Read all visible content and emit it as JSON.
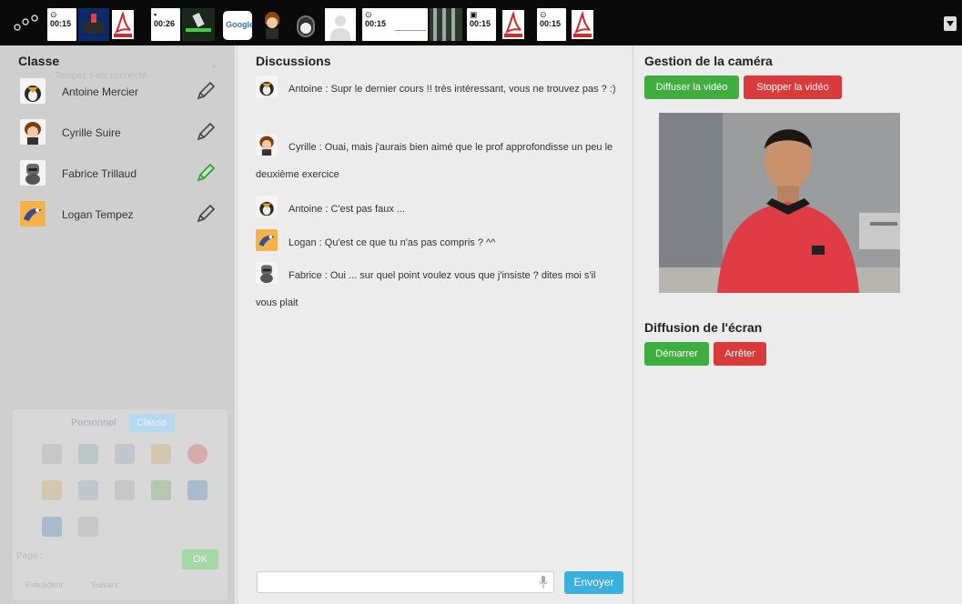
{
  "topbar": {
    "tiles": [
      {
        "time": "00:15"
      },
      {
        "time": "00:26"
      },
      {
        "time": "00:15"
      },
      {
        "time": "00:15"
      },
      {
        "time": "00:15"
      }
    ],
    "google_label": "Google"
  },
  "classe": {
    "title": "Classe",
    "ghost_text": "Tempez s'est connecté",
    "ghost_tabs": [
      "Personnel",
      "Classe"
    ],
    "ghost_page": "Page :",
    "ghost_ok": "OK",
    "ghost_prev": "Précédent",
    "ghost_next": "Suivant",
    "students": [
      {
        "name": "Antoine Mercier",
        "avatar": "penguin-avatar",
        "active": false
      },
      {
        "name": "Cyrille Suire",
        "avatar": "girl-avatar",
        "active": false
      },
      {
        "name": "Fabrice Trillaud",
        "avatar": "knight-avatar",
        "active": true
      },
      {
        "name": "Logan Tempez",
        "avatar": "bird-avatar",
        "active": false
      }
    ]
  },
  "discussions": {
    "title": "Discussions",
    "messages": [
      {
        "avatar": "penguin-avatar",
        "text": "Antoine : Supr le dernier cours !! très intéressant, vous ne trouvez pas ? :)"
      },
      {
        "avatar": "girl-avatar",
        "text": "Cyrille : Ouai, mais j'aurais bien aimé que le prof approfondisse un peu le deuxième exercice"
      },
      {
        "avatar": "penguin-avatar",
        "text": "Antoine : C'est pas faux ..."
      },
      {
        "avatar": "bird-avatar",
        "text": "Logan : Qu'est ce que tu n'as pas compris ? ^^"
      },
      {
        "avatar": "knight-avatar",
        "text": "Fabrice : Oui ... sur quel point voulez vous que j'insiste ? dites moi s'il vous plait"
      }
    ],
    "input_placeholder": "",
    "send_label": "Envoyer"
  },
  "camera": {
    "title": "Gestion de la caméra",
    "broadcast_label": "Diffuser la vidéo",
    "stop_label": "Stopper la vidéo",
    "screen_title": "Diffusion de l'écran",
    "start_label": "Démarrer",
    "halt_label": "Arrêter"
  },
  "colors": {
    "green": "#3fae3f",
    "red": "#d93b3b",
    "blue": "#3ab0de",
    "active_pencil": "#3fae3f"
  }
}
